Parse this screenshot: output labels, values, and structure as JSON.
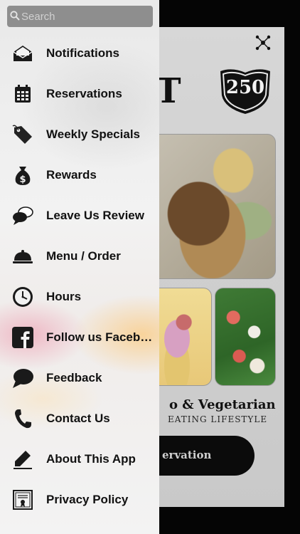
{
  "search": {
    "placeholder": "Search"
  },
  "menu": {
    "items": [
      {
        "label": "Notifications",
        "icon": "envelope-icon"
      },
      {
        "label": "Reservations",
        "icon": "calendar-icon"
      },
      {
        "label": "Weekly Specials",
        "icon": "tag-icon"
      },
      {
        "label": "Rewards",
        "icon": "money-bag-icon"
      },
      {
        "label": "Leave Us Review",
        "icon": "speech-bubbles-icon"
      },
      {
        "label": "Menu / Order",
        "icon": "cloche-icon"
      },
      {
        "label": "Hours",
        "icon": "clock-icon"
      },
      {
        "label": "Follow us Facebook",
        "icon": "facebook-icon"
      },
      {
        "label": "Feedback",
        "icon": "chat-bubble-icon"
      },
      {
        "label": "Contact Us",
        "icon": "phone-icon"
      },
      {
        "label": "About This App",
        "icon": "pencil-icon"
      },
      {
        "label": "Privacy Policy",
        "icon": "certificate-icon"
      }
    ]
  },
  "background": {
    "logo_text": "UT",
    "logo_number": "250",
    "tagline": "o & Vegetarian",
    "subtagline": "EATING LIFESTYLE",
    "reserve_button": "ervation"
  }
}
